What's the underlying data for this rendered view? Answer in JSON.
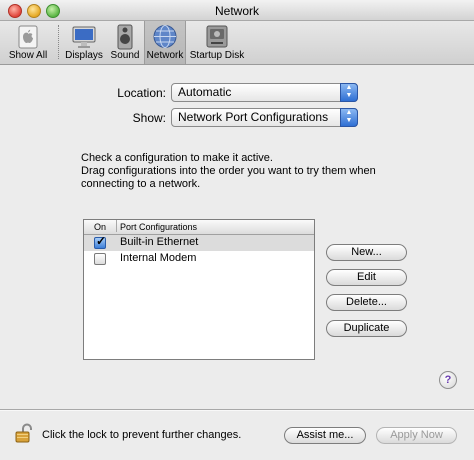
{
  "window": {
    "title": "Network"
  },
  "toolbar": {
    "items": [
      {
        "label": "Show All",
        "icon": "apple-icon"
      },
      {
        "label": "Displays",
        "icon": "display-icon"
      },
      {
        "label": "Sound",
        "icon": "speaker-icon"
      },
      {
        "label": "Network",
        "icon": "globe-icon",
        "selected": true
      },
      {
        "label": "Startup Disk",
        "icon": "hard-disk-icon"
      }
    ]
  },
  "location": {
    "label": "Location:",
    "value": "Automatic"
  },
  "show": {
    "label": "Show:",
    "value": "Network Port Configurations"
  },
  "instructions": {
    "line1": "Check a configuration to make it active.",
    "line2": "Drag configurations into the order you want to try them when",
    "line3": "connecting to a network."
  },
  "table": {
    "headers": {
      "on": "On",
      "port": "Port Configurations"
    },
    "rows": [
      {
        "name": "Built-in Ethernet",
        "checked": true
      },
      {
        "name": "Internal Modem",
        "checked": false
      }
    ]
  },
  "buttons": {
    "new": "New...",
    "edit": "Edit",
    "delete": "Delete...",
    "duplicate": "Duplicate"
  },
  "help": {
    "label": "?"
  },
  "footer": {
    "lock_text": "Click the lock to prevent further changes.",
    "assist": "Assist me...",
    "apply": "Apply Now"
  },
  "colors": {
    "selection_gray": "#dcdcdc",
    "aqua_blue": "#2f6fd3",
    "window_bg": "#ececec"
  }
}
